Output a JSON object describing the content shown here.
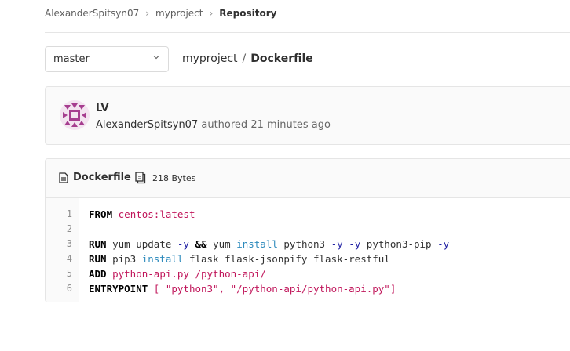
{
  "breadcrumb": {
    "user": "AlexanderSpitsyn07",
    "project": "myproject",
    "current": "Repository"
  },
  "branch": {
    "selected": "master"
  },
  "path": {
    "project": "myproject",
    "separator": "/",
    "file": "Dockerfile"
  },
  "commit": {
    "title": "LV",
    "author": "AlexanderSpitsyn07",
    "action": "authored",
    "time": "21 minutes ago"
  },
  "file": {
    "name": "Dockerfile",
    "size": "218 Bytes",
    "lines": [
      {
        "num": "1",
        "tokens": [
          [
            "kw",
            "FROM"
          ],
          [
            "",
            " "
          ],
          [
            "str",
            "centos:latest"
          ]
        ]
      },
      {
        "num": "2",
        "tokens": []
      },
      {
        "num": "3",
        "tokens": [
          [
            "kw",
            "RUN"
          ],
          [
            "",
            " yum update "
          ],
          [
            "flag",
            "-y"
          ],
          [
            "",
            " "
          ],
          [
            "kw",
            "&&"
          ],
          [
            "",
            " yum "
          ],
          [
            "inst",
            "install"
          ],
          [
            "",
            " python3 "
          ],
          [
            "flag",
            "-y"
          ],
          [
            "",
            " "
          ],
          [
            "flag",
            "-y"
          ],
          [
            "",
            " python3-pip "
          ],
          [
            "flag",
            "-y"
          ]
        ]
      },
      {
        "num": "4",
        "tokens": [
          [
            "kw",
            "RUN"
          ],
          [
            "",
            " pip3 "
          ],
          [
            "inst",
            "install"
          ],
          [
            "",
            " flask flask-jsonpify flask-restful"
          ]
        ]
      },
      {
        "num": "5",
        "tokens": [
          [
            "kw",
            "ADD"
          ],
          [
            "",
            " "
          ],
          [
            "str",
            "python-api.py /python-api/"
          ]
        ]
      },
      {
        "num": "6",
        "tokens": [
          [
            "kw",
            "ENTRYPOINT"
          ],
          [
            "",
            " "
          ],
          [
            "str",
            "[ \"python3\", \"/python-api/python-api.py\"]"
          ]
        ]
      }
    ]
  },
  "colors": {
    "avatar": "#a63d8f",
    "string": "#c0155a",
    "install": "#2e8bbd"
  }
}
